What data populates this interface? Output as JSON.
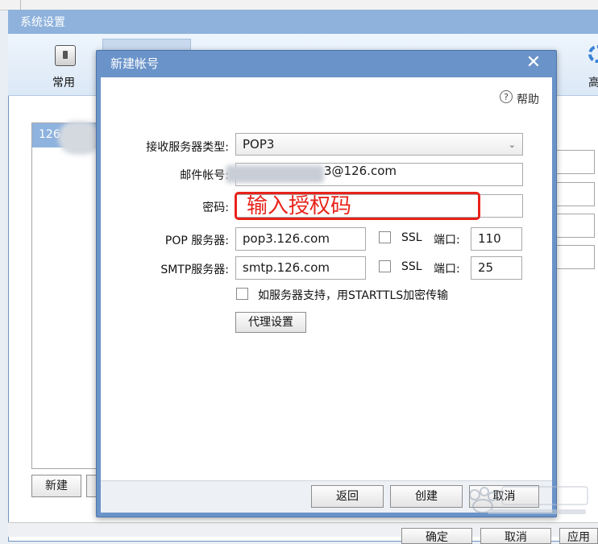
{
  "background_window": {
    "title": "系统设置",
    "toolbar": {
      "general_label": "常用",
      "advanced_label": "高级"
    },
    "account_list": {
      "selected_item": "126"
    },
    "new_button_label": "新建",
    "bottom_buttons": {
      "ok_label": "确定",
      "cancel_label": "取消",
      "apply_label": "应用"
    }
  },
  "dialog": {
    "title": "新建帐号",
    "help_label": "帮助",
    "fields": {
      "recv_server_type_label": "接收服务器类型:",
      "recv_server_type_value": "POP3",
      "email_label": "邮件帐号:",
      "email_value_visible": "3@126.com",
      "password_label": "密码:",
      "password_annotation": "输入授权码",
      "pop_server_label": "POP 服务器:",
      "pop_server_value": "pop3.126.com",
      "smtp_server_label": "SMTP服务器:",
      "smtp_server_value": "smtp.126.com",
      "ssl_label": "SSL",
      "port_label": "端口:",
      "pop_port_value": "110",
      "smtp_port_value": "25",
      "starttls_label": "如服务器支持，用STARTTLS加密传输"
    },
    "buttons": {
      "proxy_label": "代理设置",
      "back_label": "返回",
      "create_label": "创建",
      "cancel_label": "取消"
    }
  },
  "colors": {
    "accent_title": "#8eb2dc",
    "dialog_frame": "#6a93c9",
    "annotation_red": "#e8231a"
  }
}
